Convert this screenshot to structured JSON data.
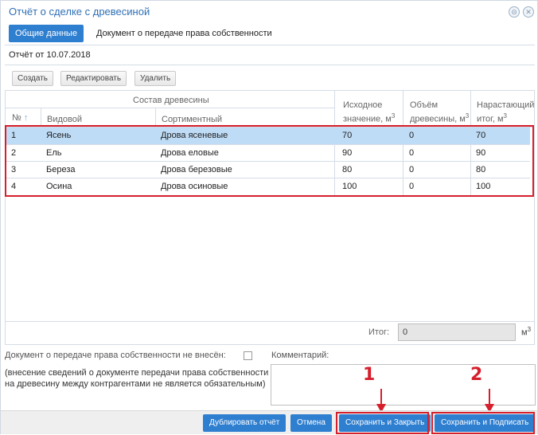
{
  "window": {
    "title": "Отчёт о сделке с древесиной"
  },
  "tabs": [
    {
      "label": "Общие данные",
      "active": true
    },
    {
      "label": "Документ о передаче права собственности",
      "active": false
    }
  ],
  "report_date": "Отчёт от 10.07.2018",
  "toolbar": {
    "create": "Создать",
    "edit": "Редактировать",
    "delete": "Удалить"
  },
  "table": {
    "group_header": "Состав древесины",
    "columns": {
      "num": "№",
      "species": "Видовой",
      "assortment": "Сортиментный",
      "initial_line1": "Исходное",
      "initial_line2": "значение, м",
      "volume_line1": "Объём",
      "volume_line2": "древесины, м",
      "cumulative_line1": "Нарастающий",
      "cumulative_line2": "итог, м",
      "unit_sup": "3"
    },
    "rows": [
      {
        "num": "1",
        "species": "Ясень",
        "assortment": "Дрова ясеневые",
        "initial": "70",
        "volume": "0",
        "cumulative": "70"
      },
      {
        "num": "2",
        "species": "Ель",
        "assortment": "Дрова еловые",
        "initial": "90",
        "volume": "0",
        "cumulative": "90"
      },
      {
        "num": "3",
        "species": "Береза",
        "assortment": "Дрова березовые",
        "initial": "80",
        "volume": "0",
        "cumulative": "80"
      },
      {
        "num": "4",
        "species": "Осина",
        "assortment": "Дрова осиновые",
        "initial": "100",
        "volume": "0",
        "cumulative": "100"
      }
    ],
    "total_label": "Итог:",
    "total_value": "0",
    "total_unit": "м",
    "total_unit_sup": "3"
  },
  "document": {
    "not_entered_label": "Документ о передаче права собственности не внесён:",
    "comment_label": "Комментарий:",
    "note": "(внесение сведений о документе передачи права собственности на древесину между контрагентами не является обязательным)"
  },
  "footer": {
    "duplicate": "Дублировать отчёт",
    "cancel": "Отмена",
    "save_close": "Сохранить и Закрыть",
    "save_sign": "Сохранить и Подписать"
  },
  "annotations": {
    "marker1": "1",
    "marker2": "2"
  },
  "colors": {
    "accent": "#2f7fd0",
    "selection": "#bfdcf6",
    "highlight": "#d61f2c"
  }
}
